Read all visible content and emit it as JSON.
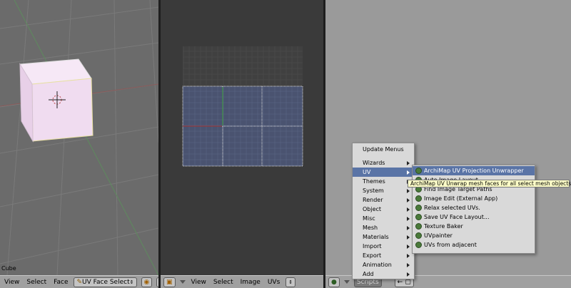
{
  "viewport_3d": {
    "object_label": "Cube",
    "menus": [
      "View",
      "Select",
      "Face"
    ],
    "mode_select": "UV Face Select"
  },
  "uv_editor": {
    "menus": [
      "View",
      "Select",
      "Image",
      "UVs"
    ]
  },
  "scripts_window": {
    "header_button": "Scripts",
    "menu": {
      "title": "Update Menus",
      "items": [
        "Wizards",
        "UV",
        "Themes",
        "System",
        "Render",
        "Object",
        "Misc",
        "Mesh",
        "Materials",
        "Import",
        "Export",
        "Animation",
        "Add"
      ],
      "selected": "UV"
    },
    "submenu": {
      "items": [
        "ArchiMap UV Projection Unwrapper",
        "Auto Image Layout",
        "Find Image Target Paths",
        "Image Edit (External App)",
        "Relax selected UVs.",
        "Save UV Face Layout...",
        "Texture Baker",
        "UVpainter",
        "UVs from adjacent"
      ],
      "selected": "ArchiMap UV Projection Unwrapper"
    },
    "tooltip": "ArchiMap UV Unwrap mesh faces for all select mesh objects"
  },
  "colors": {
    "selection": "#5a74a6",
    "cube_face": "#f3dff3",
    "uv_face": "#4a5370",
    "tooltip_bg": "#ffffc8"
  }
}
